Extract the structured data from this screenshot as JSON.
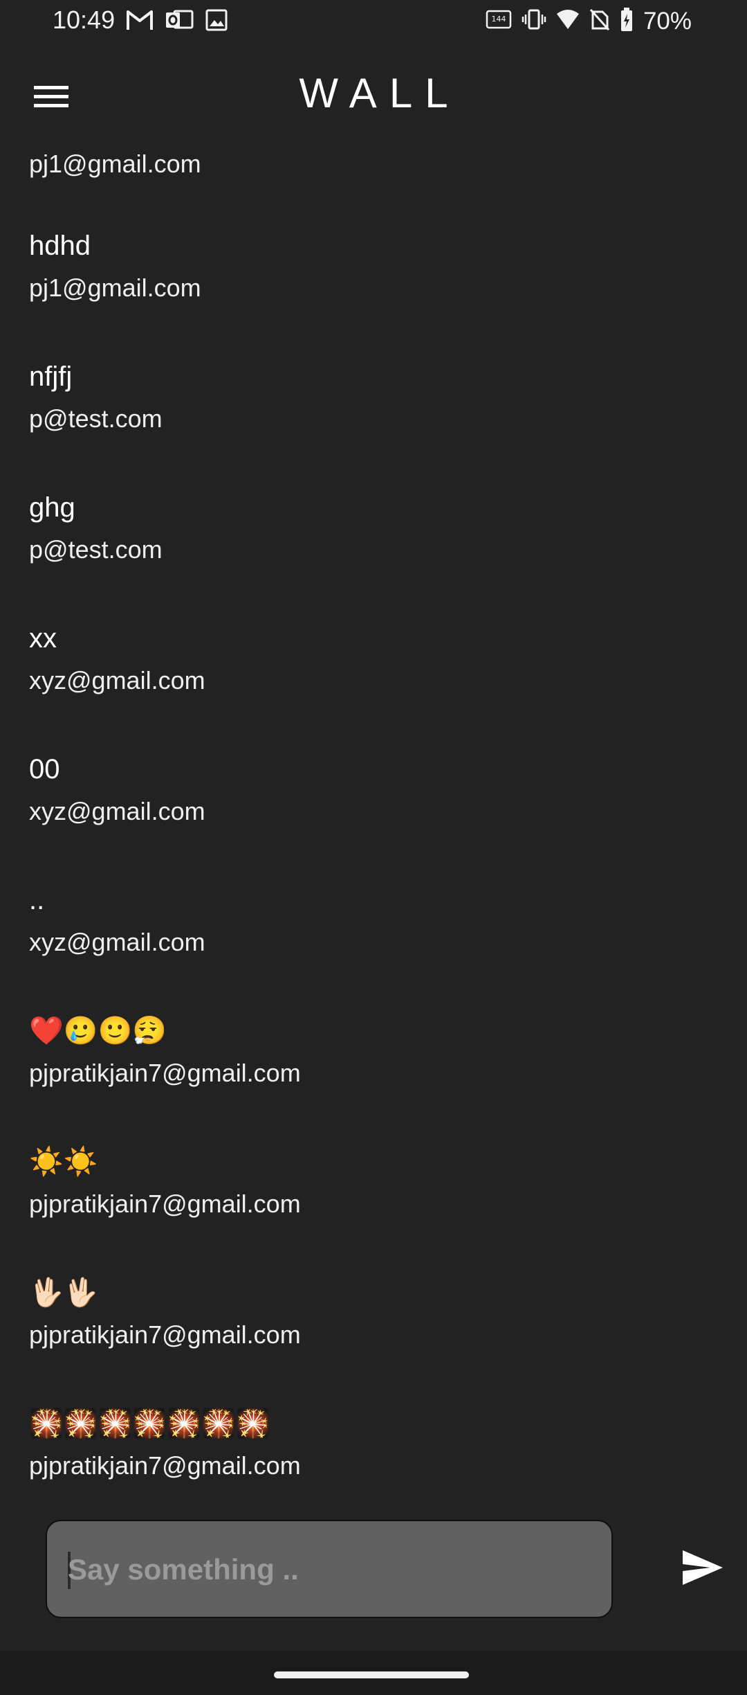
{
  "status_bar": {
    "time": "10:49",
    "battery_text": "70%",
    "left_icons": [
      "gmail-icon",
      "outlook-icon",
      "image-icon"
    ],
    "right_icons": [
      "refresh-rate-144hz-icon",
      "vibrate-icon",
      "wifi-icon",
      "no-sim-icon",
      "battery-charging-icon"
    ]
  },
  "app_bar": {
    "title": "WALL",
    "menu_icon": "hamburger-menu-icon"
  },
  "messages": [
    {
      "text": "",
      "email": "pj1@gmail.com"
    },
    {
      "text": "hdhd",
      "email": "pj1@gmail.com"
    },
    {
      "text": "nfjfj",
      "email": "p@test.com"
    },
    {
      "text": "ghg",
      "email": "p@test.com"
    },
    {
      "text": "xx",
      "email": "xyz@gmail.com"
    },
    {
      "text": "00",
      "email": "xyz@gmail.com"
    },
    {
      "text": "..",
      "email": "xyz@gmail.com"
    },
    {
      "text": "❤️🥲🙂😮‍💨",
      "email": "pjpratikjain7@gmail.com"
    },
    {
      "text": "☀️☀️",
      "email": "pjpratikjain7@gmail.com"
    },
    {
      "text": "🖖🏻🖖🏻",
      "email": "pjpratikjain7@gmail.com"
    },
    {
      "text": "🎇🎇🎇🎇🎇🎇🎇",
      "email": "pjpratikjain7@gmail.com"
    }
  ],
  "composer": {
    "placeholder": "Say something ..",
    "value": "",
    "send_icon": "send-icon"
  },
  "colors": {
    "background": "#222222",
    "input_fill": "#616161",
    "text": "#ffffff"
  }
}
